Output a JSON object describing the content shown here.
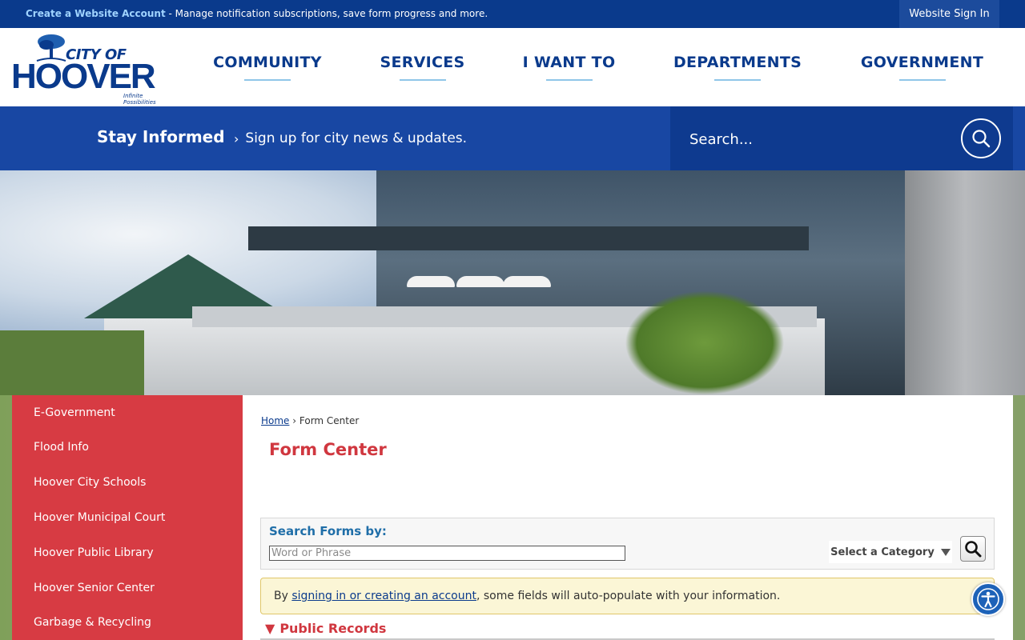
{
  "topbar": {
    "create_account": "Create a Website Account",
    "message": " - Manage notification subscriptions, save form progress and more.",
    "signin": "Website Sign In"
  },
  "logo": {
    "city_of": "CITY OF",
    "name": "HOOVER",
    "tagline": "Infinite Possibilities"
  },
  "nav": [
    "COMMUNITY",
    "SERVICES",
    "I WANT TO",
    "DEPARTMENTS",
    "GOVERNMENT"
  ],
  "band": {
    "title": "Stay Informed",
    "signup": "Sign up for city news & updates.",
    "search_placeholder": "Search..."
  },
  "sidebar": {
    "items": [
      "E-Government",
      "Flood Info",
      "Hoover City Schools",
      "Hoover Municipal Court",
      "Hoover Public Library",
      "Hoover Senior Center",
      "Garbage & Recycling"
    ]
  },
  "main": {
    "breadcrumb_home": "Home",
    "breadcrumb_sep": " › ",
    "breadcrumb_current": "Form Center",
    "title": "Form Center",
    "search_label": "Search Forms by:",
    "search_placeholder": "Word or Phrase",
    "category": "Select a Category",
    "notice_prefix": "By ",
    "notice_link": "signing in or creating an account",
    "notice_suffix": ", some fields will auto-populate with your information.",
    "section_arrow": "▼",
    "section_title": "Public Records"
  },
  "colors": {
    "navy": "#0a3a8c",
    "band_blue": "#1847a3",
    "sidebar_red": "#d73b43",
    "title_red": "#d0373f"
  }
}
